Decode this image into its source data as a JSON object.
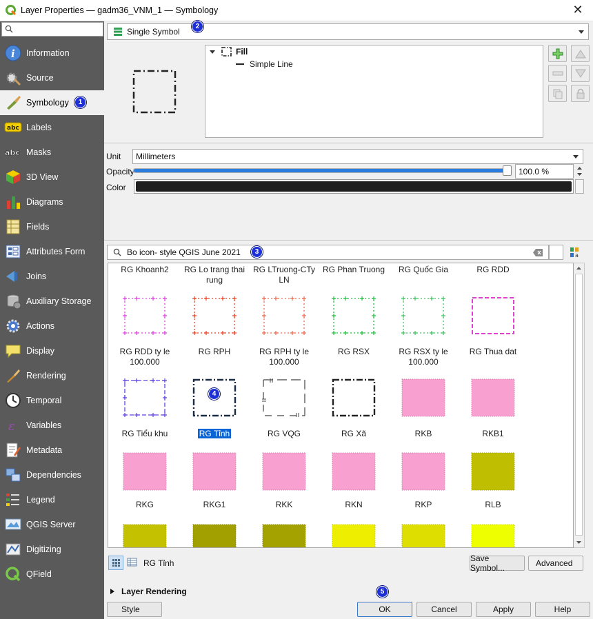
{
  "window": {
    "title": "Layer Properties — gadm36_VNM_1 — Symbology",
    "close_glyph": "✕"
  },
  "sidebar": {
    "items": [
      {
        "label": "Information",
        "icon": "information-icon"
      },
      {
        "label": "Source",
        "icon": "source-icon"
      },
      {
        "label": "Symbology",
        "icon": "symbology-brush-icon"
      },
      {
        "label": "Labels",
        "icon": "labels-abc-icon"
      },
      {
        "label": "Masks",
        "icon": "masks-abc-icon"
      },
      {
        "label": "3D View",
        "icon": "cube-3d-icon"
      },
      {
        "label": "Diagrams",
        "icon": "diagrams-icon"
      },
      {
        "label": "Fields",
        "icon": "fields-icon"
      },
      {
        "label": "Attributes Form",
        "icon": "attributes-form-icon"
      },
      {
        "label": "Joins",
        "icon": "joins-icon"
      },
      {
        "label": "Auxiliary Storage",
        "icon": "auxiliary-storage-icon"
      },
      {
        "label": "Actions",
        "icon": "actions-gear-icon"
      },
      {
        "label": "Display",
        "icon": "display-speech-icon"
      },
      {
        "label": "Rendering",
        "icon": "rendering-brush-icon"
      },
      {
        "label": "Temporal",
        "icon": "temporal-clock-icon"
      },
      {
        "label": "Variables",
        "icon": "variables-icon"
      },
      {
        "label": "Metadata",
        "icon": "metadata-icon"
      },
      {
        "label": "Dependencies",
        "icon": "dependencies-icon"
      },
      {
        "label": "Legend",
        "icon": "legend-icon"
      },
      {
        "label": "QGIS Server",
        "icon": "qgis-server-icon"
      },
      {
        "label": "Digitizing",
        "icon": "digitizing-icon"
      },
      {
        "label": "QField",
        "icon": "qfield-icon"
      }
    ]
  },
  "renderer": {
    "value": "Single Symbol"
  },
  "tree": {
    "fill": "Fill",
    "line": "Simple Line"
  },
  "unit": {
    "label": "Unit",
    "value": "Millimeters"
  },
  "opacity": {
    "label": "Opacity",
    "value": "100.0 %",
    "fraction": 1.0
  },
  "color": {
    "label": "Color",
    "value_hex": "#1e1e1e"
  },
  "library": {
    "search_value": "Bo icon- style QGIS June 2021",
    "header_row": [
      "RG Khoanh2",
      "RG Lo trang thai rung",
      "RG LTruong-CTy LN",
      "RG Phan Truong",
      "RG Quốc Gia",
      "RG RDD"
    ],
    "rows": [
      [
        {
          "label": "RG RDD ty le 100.000",
          "style": "cross",
          "color": "#e040e0"
        },
        {
          "label": "RG RPH",
          "style": "cross",
          "color": "#e84020"
        },
        {
          "label": "RG RPH ty le 100.000",
          "style": "cross",
          "color": "#ee6a50"
        },
        {
          "label": "RG RSX",
          "style": "cross",
          "color": "#20c040"
        },
        {
          "label": "RG RSX ty le 100.000",
          "style": "cross",
          "color": "#40c060"
        },
        {
          "label": "RG Thua dat",
          "style": "dash",
          "color": "#e040d0"
        }
      ],
      [
        {
          "label": "RG Tiểu khu",
          "style": "dashcross",
          "color": "#6040e0"
        },
        {
          "label": "RG Tỉnh",
          "style": "dashdot",
          "color": "#1a2c44",
          "selected": true
        },
        {
          "label": "RG VQG",
          "style": "vqg",
          "color": "#444444"
        },
        {
          "label": "RG Xã",
          "style": "dashdot",
          "color": "#222222"
        },
        {
          "label": "RKB",
          "style": "solid",
          "color": "#f8a0d0"
        },
        {
          "label": "RKB1",
          "style": "solid",
          "color": "#f8a0d0"
        }
      ],
      [
        {
          "label": "RKG",
          "style": "solid",
          "color": "#f8a0d0"
        },
        {
          "label": "RKG1",
          "style": "solid",
          "color": "#f8a0d0"
        },
        {
          "label": "RKK",
          "style": "solid",
          "color": "#f8a0d0"
        },
        {
          "label": "RKN",
          "style": "solid",
          "color": "#f8a0d0"
        },
        {
          "label": "RKP",
          "style": "solid",
          "color": "#f8a0d0"
        },
        {
          "label": "RLB",
          "style": "solid",
          "color": "#c0be00"
        }
      ],
      [
        {
          "label": "",
          "style": "solid",
          "color": "#c4c200"
        },
        {
          "label": "",
          "style": "solid",
          "color": "#a2a000"
        },
        {
          "label": "",
          "style": "solid",
          "color": "#a4a200"
        },
        {
          "label": "",
          "style": "solid",
          "color": "#eeee00"
        },
        {
          "label": "",
          "style": "solid",
          "color": "#dede00"
        },
        {
          "label": "",
          "style": "solid",
          "color": "#eeff00"
        }
      ]
    ],
    "selected_name": "RG Tỉnh",
    "save_symbol": "Save Symbol...",
    "advanced": "Advanced"
  },
  "layer_rendering": "Layer Rendering",
  "footer": {
    "style": "Style",
    "ok": "OK",
    "cancel": "Cancel",
    "apply": "Apply",
    "help": "Help"
  },
  "badges": [
    "1",
    "2",
    "3",
    "4",
    "5"
  ]
}
